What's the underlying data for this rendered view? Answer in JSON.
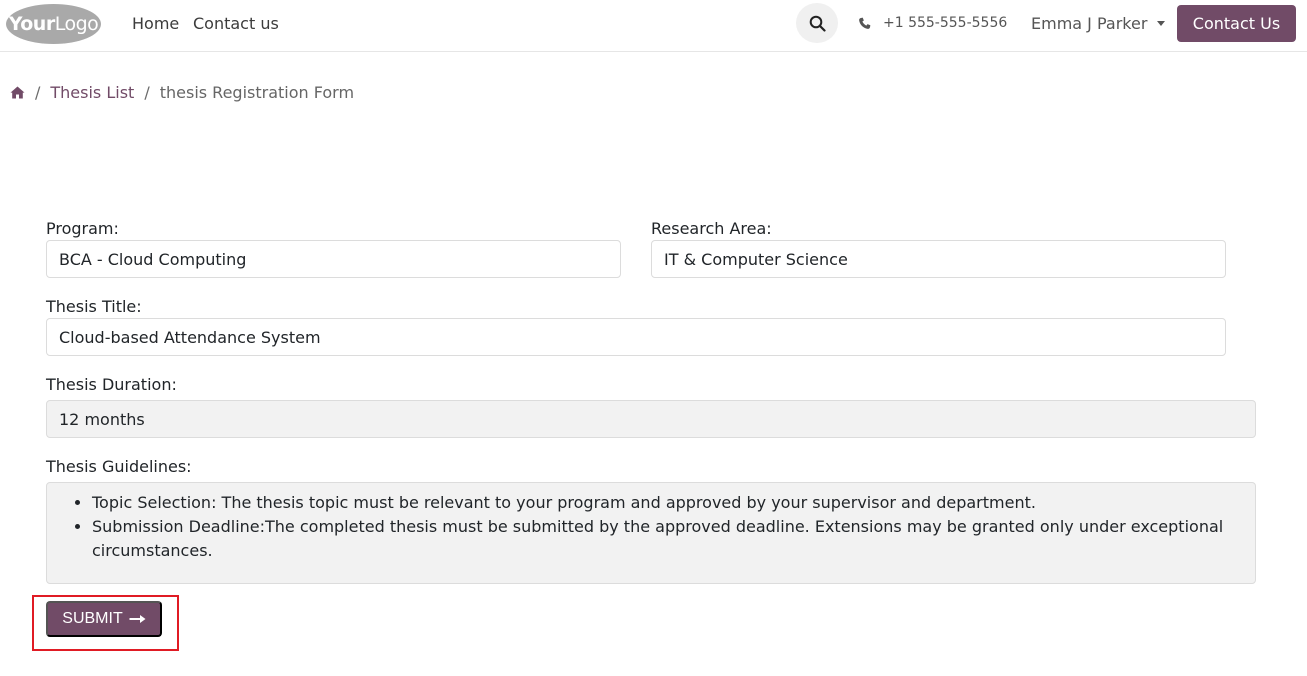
{
  "header": {
    "logo": {
      "bold": "Your",
      "light": "Logo"
    },
    "nav": [
      "Home",
      "Contact us"
    ],
    "phone": "+1 555-555-5556",
    "user": "Emma J Parker",
    "contact_button": "Contact Us"
  },
  "breadcrumb": {
    "items": [
      "Thesis List",
      "thesis Registration Form"
    ]
  },
  "form": {
    "program": {
      "label": "Program:",
      "value": "BCA - Cloud Computing"
    },
    "research_area": {
      "label": "Research Area:",
      "value": "IT & Computer Science"
    },
    "thesis_title": {
      "label": "Thesis Title:",
      "value": "Cloud-based Attendance System"
    },
    "thesis_duration": {
      "label": "Thesis Duration:",
      "value": "12 months"
    },
    "guidelines": {
      "label": "Thesis Guidelines:",
      "items": [
        "Topic Selection: The thesis topic must be relevant to your program and approved by your supervisor and department.",
        "Submission Deadline:The completed thesis must be submitted by the approved deadline. Extensions may be granted only under exceptional circumstances."
      ]
    },
    "submit_label": "SUBMIT"
  },
  "colors": {
    "brand": "#714b67",
    "highlight": "#e01b24"
  }
}
